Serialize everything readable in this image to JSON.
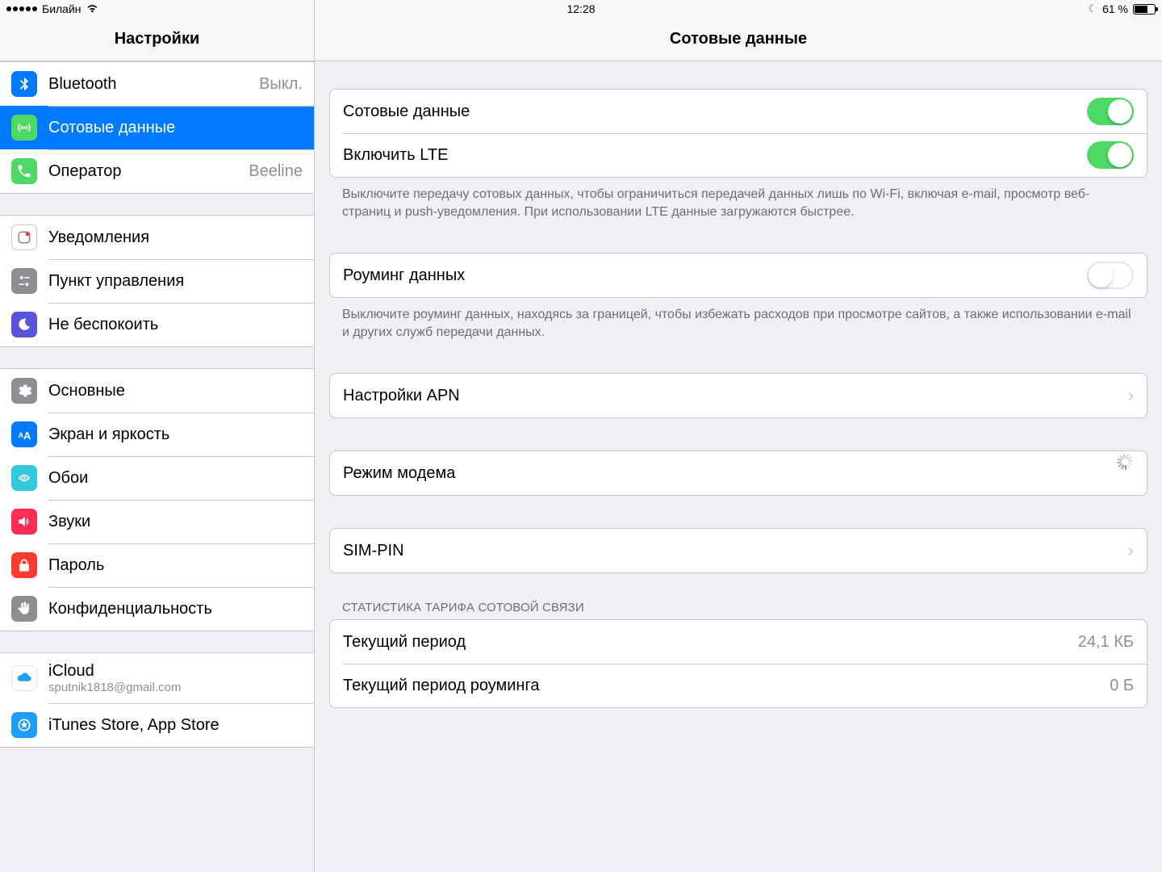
{
  "status": {
    "carrier": "Билайн",
    "time": "12:28",
    "battery_pct": "61 %",
    "battery_fill_pct": 61
  },
  "sidebar": {
    "title": "Настройки",
    "groups": [
      {
        "items": [
          {
            "key": "bluetooth",
            "label": "Bluetooth",
            "value": "Выкл.",
            "icon": "bluetooth",
            "color": "#007aff"
          },
          {
            "key": "cellular",
            "label": "Сотовые данные",
            "icon": "cellular",
            "color": "#4cd964",
            "selected": true
          },
          {
            "key": "carrier",
            "label": "Оператор",
            "value": "Beeline",
            "icon": "phone",
            "color": "#4cd964"
          }
        ]
      },
      {
        "items": [
          {
            "key": "notifications",
            "label": "Уведомления",
            "icon": "notifications",
            "color": "#8e8e93"
          },
          {
            "key": "controlcenter",
            "label": "Пункт управления",
            "icon": "controlcenter",
            "color": "#8e8e93"
          },
          {
            "key": "dnd",
            "label": "Не беспокоить",
            "icon": "moon",
            "color": "#5856d6"
          }
        ]
      },
      {
        "items": [
          {
            "key": "general",
            "label": "Основные",
            "icon": "gear",
            "color": "#8e8e93"
          },
          {
            "key": "display",
            "label": "Экран и яркость",
            "icon": "textsize",
            "color": "#007aff"
          },
          {
            "key": "wallpaper",
            "label": "Обои",
            "icon": "wallpaper",
            "color": "#35c8dc"
          },
          {
            "key": "sounds",
            "label": "Звуки",
            "icon": "speaker",
            "color": "#ff2d55"
          },
          {
            "key": "passcode",
            "label": "Пароль",
            "icon": "lock",
            "color": "#ff3b30"
          },
          {
            "key": "privacy",
            "label": "Конфиденциальность",
            "icon": "hand",
            "color": "#8e8e93"
          }
        ]
      },
      {
        "items": [
          {
            "key": "icloud",
            "label": "iCloud",
            "sub": "sputnik1818@gmail.com",
            "icon": "cloud",
            "color": "#ffffff"
          },
          {
            "key": "itunes",
            "label": "iTunes Store, App Store",
            "icon": "appstore",
            "color": "#1f9ef7"
          }
        ]
      }
    ]
  },
  "detail": {
    "title": "Сотовые данные",
    "rows": {
      "cellular_data": "Сотовые данные",
      "enable_lte": "Включить LTE",
      "roaming": "Роуминг данных",
      "apn_settings": "Настройки APN",
      "hotspot": "Режим модема",
      "sim_pin": "SIM-PIN"
    },
    "footers": {
      "after_lte": "Выключите передачу сотовых данных, чтобы ограничиться передачей данных лишь по Wi-Fi, включая e-mail, просмотр веб-страниц и push-уведомления. При использовании LTE данные загружаются быстрее.",
      "after_roaming": "Выключите роуминг данных, находясь за границей, чтобы избежать расходов при просмотре сайтов, а также использовании e-mail и других служб передачи данных."
    },
    "stats": {
      "header": "СТАТИСТИКА ТАРИФА СОТОВОЙ СВЯЗИ",
      "current_period_label": "Текущий период",
      "current_period_value": "24,1 КБ",
      "roaming_period_label": "Текущий период роуминга",
      "roaming_period_value": "0 Б"
    }
  }
}
